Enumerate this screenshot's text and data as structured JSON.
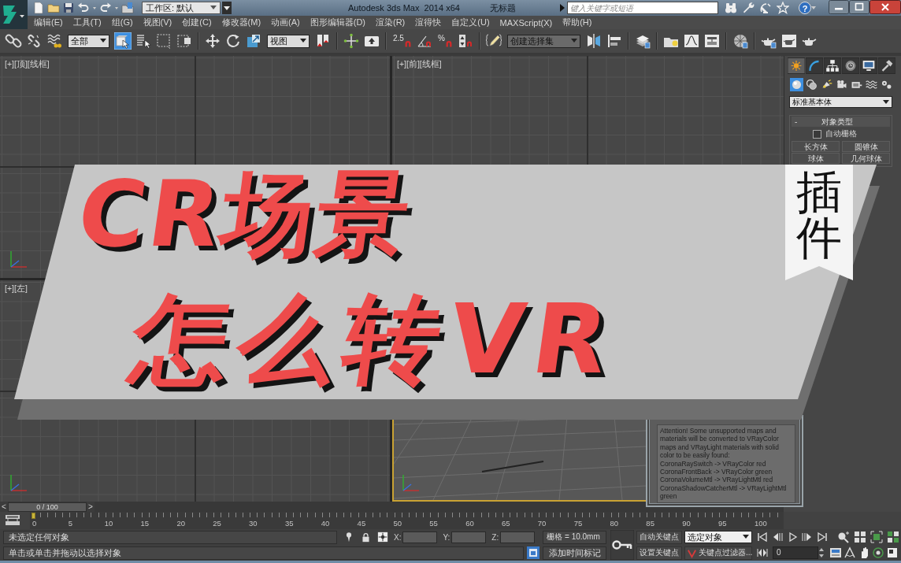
{
  "title_bar": {
    "workspace": "工作区: 默认",
    "title": "Autodesk 3ds Max  2014 x64",
    "document": "无标题",
    "search": {
      "placeholder": "键入关键字或短语"
    },
    "help": "?"
  },
  "menu_bar": [
    "编辑(E)",
    "工具(T)",
    "组(G)",
    "视图(V)",
    "创建(C)",
    "修改器(M)",
    "动画(A)",
    "图形编辑器(D)",
    "渲染(R)",
    "渲得快",
    "自定义(U)",
    "MAXScript(X)",
    "帮助(H)"
  ],
  "main_toolbar": [
    [
      {
        "kind": "link",
        "selected": false
      },
      {
        "kind": "unlink",
        "selected": false
      },
      {
        "kind": "bind",
        "selected": false
      },
      {
        "kind": "dropdown",
        "value": "全部"
      },
      {
        "kind": "select",
        "selected": true
      },
      {
        "kind": "select-by-name",
        "selected": false
      },
      {
        "kind": "region",
        "selected": false
      },
      {
        "kind": "crossing",
        "selected": false
      }
    ],
    [
      {
        "kind": "move",
        "selected": false
      },
      {
        "kind": "rotate",
        "selected": false
      },
      {
        "kind": "scale",
        "selected": false
      },
      {
        "kind": "dropdown",
        "value": "视图"
      },
      {
        "kind": "pivot",
        "selected": false
      }
    ],
    [
      {
        "kind": "manipulate",
        "selected": false
      },
      {
        "kind": "keyboard",
        "selected": false
      }
    ],
    [
      {
        "kind": "snap",
        "label": "2.5",
        "selected": false
      },
      {
        "kind": "angle-snap",
        "selected": false
      },
      {
        "kind": "snap",
        "label": "%",
        "selected": false
      },
      {
        "kind": "spinner-snap",
        "selected": false
      }
    ],
    [
      {
        "kind": "edit-named",
        "selected": false
      },
      {
        "kind": "dropdown",
        "value": "创建选择集"
      },
      {
        "kind": "mirror",
        "selected": false
      },
      {
        "kind": "align",
        "selected": false
      }
    ],
    [
      {
        "kind": "layers",
        "selected": false
      }
    ],
    [
      {
        "kind": "explorer",
        "selected": false
      },
      {
        "kind": "curve-editor",
        "selected": false
      },
      {
        "kind": "schematic",
        "selected": false
      }
    ],
    [
      {
        "kind": "material",
        "selected": false
      }
    ],
    [
      {
        "kind": "render-setup",
        "selected": false
      },
      {
        "kind": "frame-window",
        "selected": false
      },
      {
        "kind": "render",
        "selected": false
      }
    ]
  ],
  "viewports": [
    {
      "kind": "grid",
      "label": "[+][顶][线框]",
      "active": false
    },
    {
      "kind": "grid",
      "label": "[+][前][线框]",
      "active": false
    },
    {
      "kind": "grid",
      "label": "[+][左]",
      "active": false
    },
    {
      "kind": "perspective",
      "active": true
    }
  ],
  "command_panel": {
    "tabs": [
      {
        "kind": "create",
        "selected": true
      },
      {
        "kind": "modify",
        "selected": false
      },
      {
        "kind": "hierarchy",
        "selected": false
      },
      {
        "kind": "motion",
        "selected": false
      },
      {
        "kind": "display",
        "selected": false
      },
      {
        "kind": "utilities",
        "selected": false
      }
    ],
    "categories": [
      {
        "kind": "geometry",
        "selected": true
      },
      {
        "kind": "shapes",
        "selected": false
      },
      {
        "kind": "lights",
        "selected": false
      },
      {
        "kind": "cameras",
        "selected": false
      },
      {
        "kind": "helpers",
        "selected": false
      },
      {
        "kind": "spacewarps",
        "selected": false
      },
      {
        "kind": "systems",
        "selected": false
      }
    ],
    "type_dropdown": "标准基本体",
    "rollout": {
      "toggle": "-",
      "title": "对象类型",
      "autogrid": {
        "label": "自动栅格",
        "checked": false
      },
      "buttons": [
        "长方体",
        "圆锥体",
        "球体",
        "几何球体"
      ]
    }
  },
  "dialog": {
    "message": [
      "Attention! Some unsupported maps and materials will be converted to VRayColor maps and VRayLight materials with solid color to be easily found:",
      "CoronaRaySwitch -> VRayColor red",
      "CoronaFrontBack -> VRayColor green",
      "CoronaVolumeMtl -> VRayLightMtl red",
      "CoronaShadowCatcherMtl -> VRayLightMtl green"
    ]
  },
  "time_slider": {
    "prev": "<",
    "position": "0 / 100",
    "next": ">",
    "level": 0
  },
  "track_bar": {
    "ticks": [
      "0",
      "5",
      "10",
      "15",
      "20",
      "25",
      "30",
      "35",
      "40",
      "45",
      "50",
      "55",
      "60",
      "65",
      "70",
      "75",
      "80",
      "85",
      "90",
      "95",
      "100"
    ]
  },
  "status_bar": {
    "selection": "未选定任何对象",
    "prompt": "单击或单击并拖动以选择对象",
    "coordinates": [
      "X:",
      "Y:",
      "Z:"
    ],
    "grid": "栅格 = 10.0mm",
    "time_tag": "添加时间标记",
    "auto_key": {
      "label": "自动关键点",
      "on": false
    },
    "set_key": "设置关键点",
    "key_target": "选定对象",
    "key_filters": "关键点过滤器...",
    "frame": "0"
  },
  "banner": {
    "lines": [
      "CR场景",
      "怎么转VR"
    ],
    "tag": "插件"
  }
}
